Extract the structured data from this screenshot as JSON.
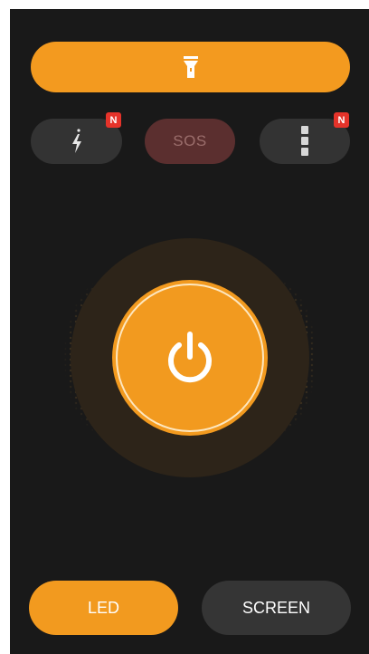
{
  "top_bar": {
    "icon": "flashlight-icon"
  },
  "quick_actions": [
    {
      "name": "flash",
      "icon": "lightning-icon",
      "badge": "N"
    },
    {
      "name": "sos",
      "label": "SOS"
    },
    {
      "name": "more",
      "icon": "more-vertical-icon",
      "badge": "N"
    }
  ],
  "power": {
    "icon": "power-icon"
  },
  "modes": {
    "led_label": "LED",
    "screen_label": "SCREEN",
    "selected": "LED"
  },
  "colors": {
    "accent": "#f29a1f",
    "background": "#191919",
    "pill": "#333333",
    "sos_bg": "#5b2f2f",
    "badge": "#e5332a"
  }
}
